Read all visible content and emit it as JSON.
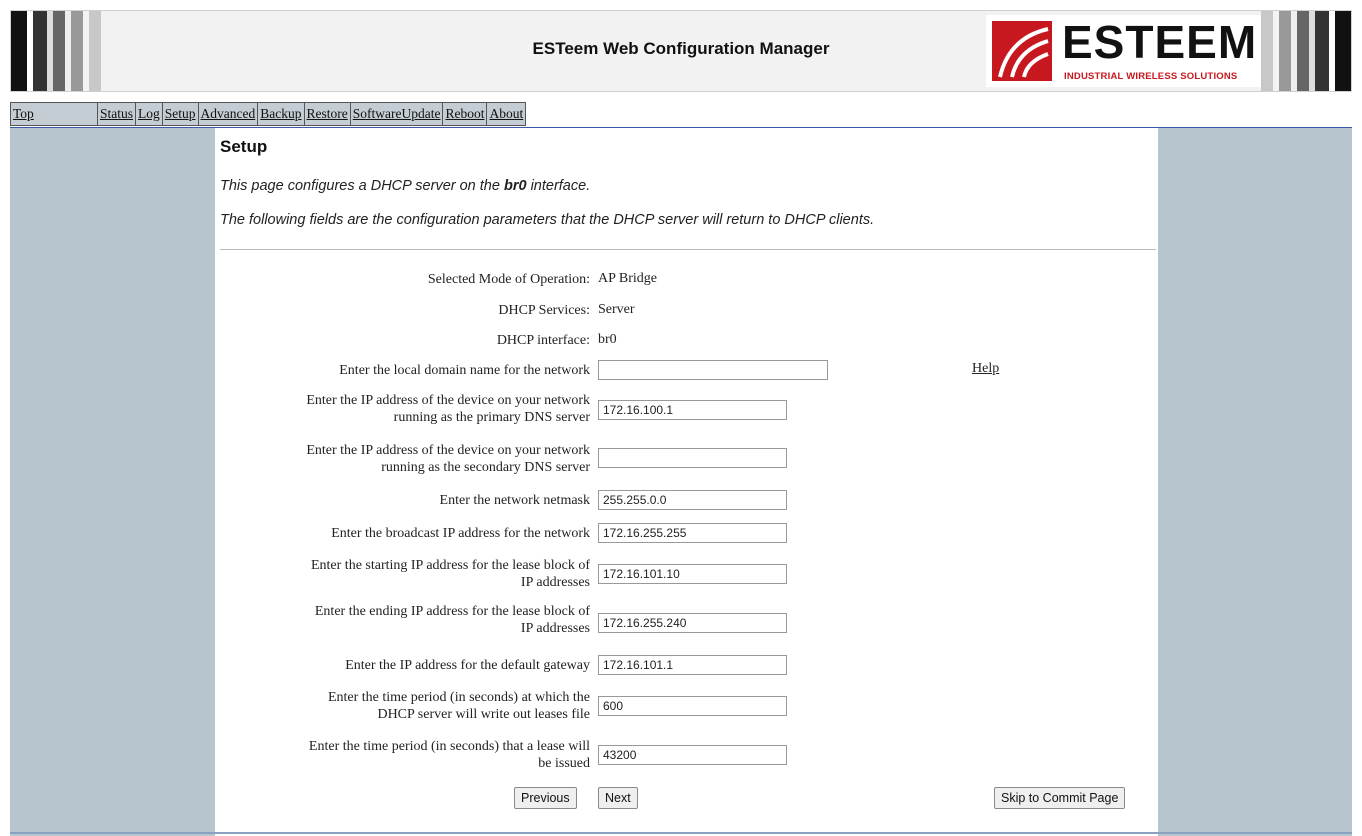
{
  "header": {
    "title": "ESTeem Web Configuration Manager",
    "logo_word": "ESTEEM",
    "logo_tagline": "INDUSTRIAL WIRELESS SOLUTIONS",
    "brand_color": "#c8181f"
  },
  "nav": {
    "items": [
      "Top",
      "Status",
      "Log",
      "Setup",
      "Advanced",
      "Backup",
      "Restore",
      "SoftwareUpdate",
      "Reboot",
      "About"
    ]
  },
  "page": {
    "title": "Setup",
    "intro_pre": "This page configures a DHCP server on the ",
    "intro_bold": "br0",
    "intro_post": " interface.",
    "intro2": "The following fields are the configuration parameters that the DHCP server will return to DHCP clients.",
    "help_label": "Help"
  },
  "info": {
    "mode_label": "Selected Mode of Operation:",
    "mode_value": "AP Bridge",
    "services_label": "DHCP Services:",
    "services_value": "Server",
    "interface_label": "DHCP interface:",
    "interface_value": "br0"
  },
  "form": {
    "domain_label": "Enter the local domain name for the network",
    "domain_value": "",
    "primary_dns_label_1": "Enter the IP address of the device on your network",
    "primary_dns_label_2": "running as the primary DNS server",
    "primary_dns_value": "172.16.100.1",
    "secondary_dns_label_1": "Enter the IP address of the device on your network",
    "secondary_dns_label_2": "running as the secondary DNS server",
    "secondary_dns_value": "",
    "netmask_label": "Enter the network netmask",
    "netmask_value": "255.255.0.0",
    "broadcast_label": "Enter the broadcast IP address for the network",
    "broadcast_value": "172.16.255.255",
    "start_label_1": "Enter the starting IP address for the lease block of",
    "start_label_2": "IP addresses",
    "start_value": "172.16.101.10",
    "end_label_1": "Enter the ending IP address for the lease block of",
    "end_label_2": "IP addresses",
    "end_value": "172.16.255.240",
    "gateway_label": "Enter the IP address for the default gateway",
    "gateway_value": "172.16.101.1",
    "write_label_1": "Enter the time period (in seconds) at which the",
    "write_label_2": "DHCP server will write out leases file",
    "write_value": "600",
    "lease_label_1": "Enter the time period (in seconds) that a lease will",
    "lease_label_2": "be issued",
    "lease_value": "43200"
  },
  "buttons": {
    "previous": "Previous",
    "next": "Next",
    "skip": "Skip to Commit Page"
  }
}
